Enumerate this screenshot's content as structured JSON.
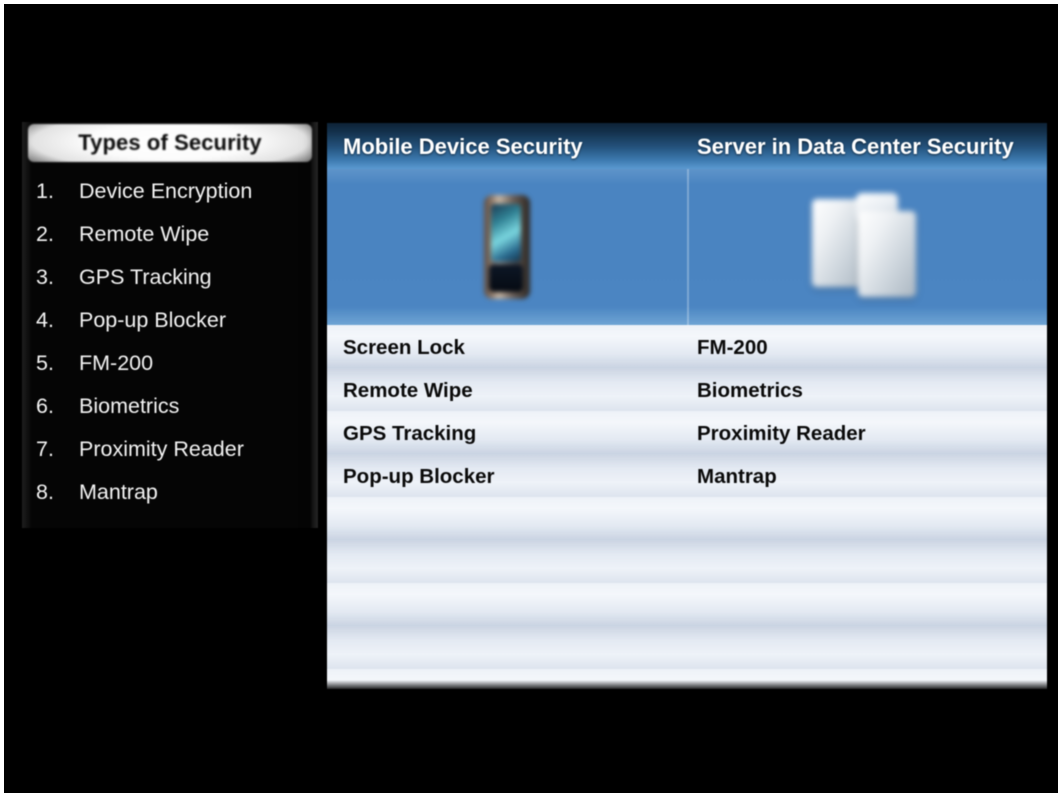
{
  "slide": {
    "background_color": "#000000",
    "frame_color": "#ffffff"
  },
  "sidebar": {
    "title": "Types of Security",
    "items": [
      {
        "number": "1.",
        "label": "Device Encryption"
      },
      {
        "number": "2.",
        "label": "Remote Wipe"
      },
      {
        "number": "3.",
        "label": "GPS Tracking"
      },
      {
        "number": "4.",
        "label": "Pop-up Blocker"
      },
      {
        "number": "5.",
        "label": "FM-200"
      },
      {
        "number": "6.",
        "label": "Biometrics"
      },
      {
        "number": "7.",
        "label": "Proximity Reader"
      },
      {
        "number": "8.",
        "label": "Mantrap"
      }
    ]
  },
  "table": {
    "headers": [
      "Mobile Device Security",
      "Server in Data Center Security"
    ],
    "header_gradient_from": "#0e2337",
    "header_gradient_to": "#5b9ad1",
    "image_row": {
      "background_color": "#4b85c2",
      "cells": [
        {
          "icon": "mobile-phone-image",
          "alt": "smartphone"
        },
        {
          "icon": "server-rack-image",
          "alt": "servers in data center"
        }
      ]
    },
    "rows": [
      {
        "col1": "Screen Lock",
        "col2": "FM-200"
      },
      {
        "col1": "Remote Wipe",
        "col2": "Biometrics"
      },
      {
        "col1": "GPS Tracking",
        "col2": "Proximity Reader"
      },
      {
        "col1": "Pop-up Blocker",
        "col2": "Mantrap"
      },
      {
        "col1": "",
        "col2": ""
      },
      {
        "col1": "",
        "col2": ""
      },
      {
        "col1": "",
        "col2": ""
      },
      {
        "col1": "",
        "col2": ""
      },
      {
        "col1": "",
        "col2": ""
      }
    ]
  }
}
